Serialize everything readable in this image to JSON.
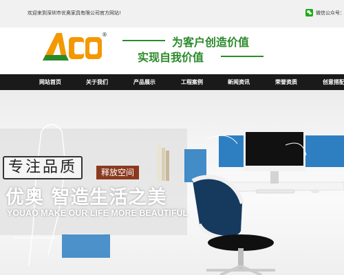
{
  "topbar": {
    "welcome": "欢迎来到深圳市优奥家具有限公司官方网站!",
    "wechat_label": "微信公众号：",
    "wechat_icon": "wechat-icon"
  },
  "header": {
    "logo_text": "AO",
    "logo_registered": "®",
    "slogan_line1": "为客户创造价值",
    "slogan_line2": "实现自我价值"
  },
  "nav": {
    "items": [
      {
        "label": "网站首页"
      },
      {
        "label": "关于我们"
      },
      {
        "label": "产品展示"
      },
      {
        "label": "工程案例"
      },
      {
        "label": "新闻资讯"
      },
      {
        "label": "荣誉资质"
      },
      {
        "label": "创意搭配"
      }
    ]
  },
  "banner": {
    "badge": "专注品质",
    "tag": "释放空间",
    "headline": "优奥 智造生活之美",
    "english": "YOUAO MAKE OUR LIFE MORE BEAUTIFUL"
  },
  "colors": {
    "brand_green": "#2a8a2a",
    "logo_orange": "#f39800",
    "nav_bg": "#1a1a1a",
    "tag_bg": "#8b3a1f",
    "desk_blue": "#2e7fc2"
  }
}
